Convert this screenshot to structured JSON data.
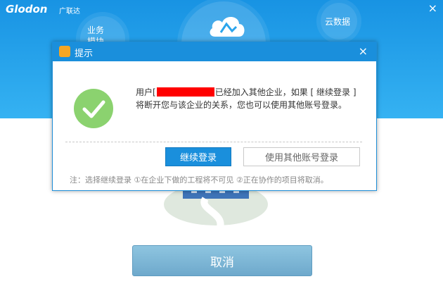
{
  "app": {
    "logo": "Glodon",
    "logo_sub": "广联达",
    "close_glyph": "×"
  },
  "header": {
    "left_bubble_label_1": "业务",
    "left_bubble_label_2": "模块",
    "right_bubble_label": "云数据"
  },
  "dialog": {
    "title": "提示",
    "close_glyph": "×",
    "message_line1_before": "用户[",
    "message_line1_after": "已经加入其他企业，如果 [ 继续登录 ]",
    "message_line2": "将断开您与该企业的关系，您也可以使用其他账号登录。",
    "continue_label": "继续登录",
    "other_account_label": "使用其他账号登录",
    "note": "注：选择继续登录 ①在企业下做的工程将不可见 ②正在协作的项目将取消。"
  },
  "cancel_label": "取消",
  "colors": {
    "header": "#2aa5ec",
    "dialog_title": "#1a8fdc",
    "success": "#8bd26f",
    "redaction": "#ff0000"
  }
}
